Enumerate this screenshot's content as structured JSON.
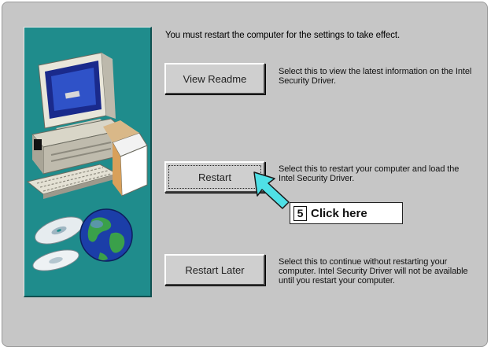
{
  "intro_text": "You must restart the computer for the settings to take effect.",
  "buttons": {
    "view_readme": "View Readme",
    "restart": "Restart",
    "restart_later": "Restart Later"
  },
  "descriptions": {
    "view_readme": "Select this to view the latest information on the Intel Security Driver.",
    "restart": "Select this to restart your computer and load the Intel Security Driver.",
    "restart_later": "Select this to continue without restarting your computer. Intel Security Driver will not be available until you restart your computer."
  },
  "callout": {
    "step": "5",
    "label": "Click here"
  },
  "colors": {
    "dialog_bg": "#c6c6c6",
    "art_panel": "#1f8c8c",
    "arrow": "#4fe0e6"
  },
  "icons": [
    "computer-illustration",
    "cd-disc-icon",
    "globe-icon",
    "pointer-arrow-icon"
  ]
}
